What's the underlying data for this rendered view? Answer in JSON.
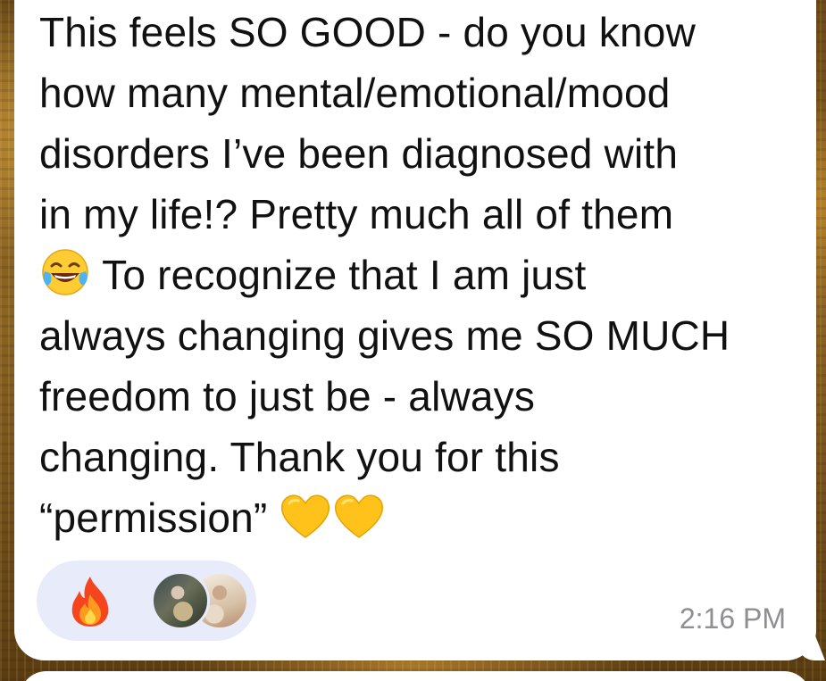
{
  "message": {
    "lines": [
      "This feels SO GOOD - do you know",
      "how many mental/emotional/mood",
      "disorders I’ve been diagnosed with",
      "in my life!? Pretty much all of them",
      " To recognize that I am just",
      "always changing gives me SO MUCH",
      "freedom to just be - always",
      "changing. Thank you for this",
      "“permission” "
    ],
    "timestamp": "2:16 PM"
  },
  "reactions": {
    "emoji": "fire-icon",
    "avatars": [
      "avatar-1",
      "avatar-2"
    ]
  },
  "icons": {
    "laughing": "face-with-tears-of-joy-icon",
    "heart": "yellow-heart-icon",
    "fire": "fire-icon"
  },
  "colors": {
    "bubble": "#ffffff",
    "reaction_pill": "#e8ecfa",
    "timestamp": "#8e8e93",
    "heart": "#ffc21a"
  }
}
